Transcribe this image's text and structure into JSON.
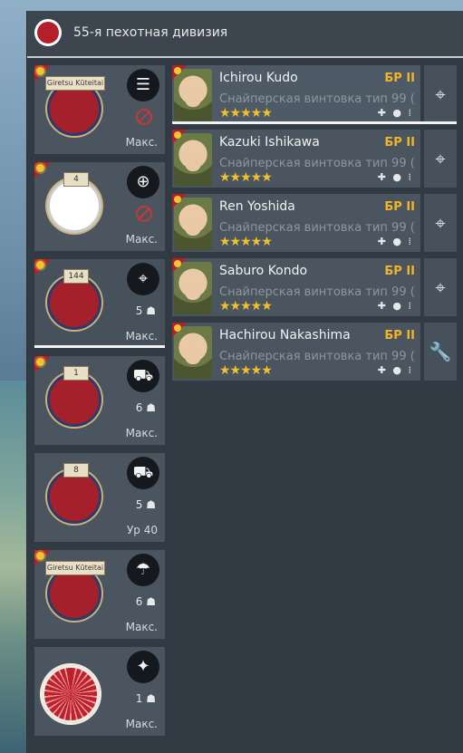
{
  "header": {
    "title": "55-я пехотная дивизия",
    "flag_color": "#b3202a"
  },
  "squads": [
    {
      "ribbon": "Giretsu Kūteitai",
      "rank": "",
      "type_icon": "list-icon",
      "type_glyph": "☰",
      "count": "",
      "blocked": true,
      "level": "Макс."
    },
    {
      "ribbon": "",
      "rank": "4",
      "type_icon": "medic-icon",
      "type_glyph": "⊕",
      "count": "",
      "blocked": true,
      "level": "Макс."
    },
    {
      "ribbon": "",
      "rank": "144",
      "type_icon": "crosshair-icon",
      "type_glyph": "⌖",
      "count": "5",
      "blocked": false,
      "level": "Макс."
    },
    {
      "ribbon": "",
      "rank": "1",
      "type_icon": "vehicle-icon",
      "type_glyph": "⛟",
      "count": "6",
      "blocked": false,
      "level": "Макс."
    },
    {
      "ribbon": "",
      "rank": "8",
      "type_icon": "tank-icon",
      "type_glyph": "⛟",
      "count": "5",
      "blocked": false,
      "level": "Ур 40"
    },
    {
      "ribbon": "Giretsu Kūteitai",
      "rank": "",
      "type_icon": "parachute-icon",
      "type_glyph": "☂",
      "count": "6",
      "blocked": false,
      "level": "Макс."
    },
    {
      "ribbon": "",
      "rank": "",
      "type_icon": "grenade-icon",
      "type_glyph": "✦",
      "count": "1",
      "blocked": false,
      "level": "Макс."
    }
  ],
  "soldiers": [
    {
      "name": "Ichirou Kudo",
      "br": "БР II",
      "weapon": "Снайперская винтовка тип 99 (",
      "stars": "★★★★★",
      "equip": "✚ ● ⁞",
      "action_icon": "crosshair-icon",
      "action_glyph": "⌖"
    },
    {
      "name": "Kazuki Ishikawa",
      "br": "БР II",
      "weapon": "Снайперская винтовка тип 99 (",
      "stars": "★★★★★",
      "equip": "✚ ● ⁞",
      "action_icon": "crosshair-icon",
      "action_glyph": "⌖"
    },
    {
      "name": "Ren Yoshida",
      "br": "БР II",
      "weapon": "Снайперская винтовка тип 99 (",
      "stars": "★★★★★",
      "equip": "✚ ● ⁞",
      "action_icon": "crosshair-icon",
      "action_glyph": "⌖"
    },
    {
      "name": "Saburo Kondo",
      "br": "БР II",
      "weapon": "Снайперская винтовка тип 99 (",
      "stars": "★★★★★",
      "equip": "✚ ● ⁞",
      "action_icon": "crosshair-icon",
      "action_glyph": "⌖"
    },
    {
      "name": "Hachirou Nakashima",
      "br": "БР II",
      "weapon": "Снайперская винтовка тип 99 (",
      "stars": "★★★★★",
      "equip": "✚ ● ⁞",
      "action_icon": "wrench-icon",
      "action_glyph": "🔧"
    }
  ],
  "colors": {
    "accent_gold": "#f0b429",
    "star": "#f2c02c",
    "japan_red": "#b3202a"
  }
}
